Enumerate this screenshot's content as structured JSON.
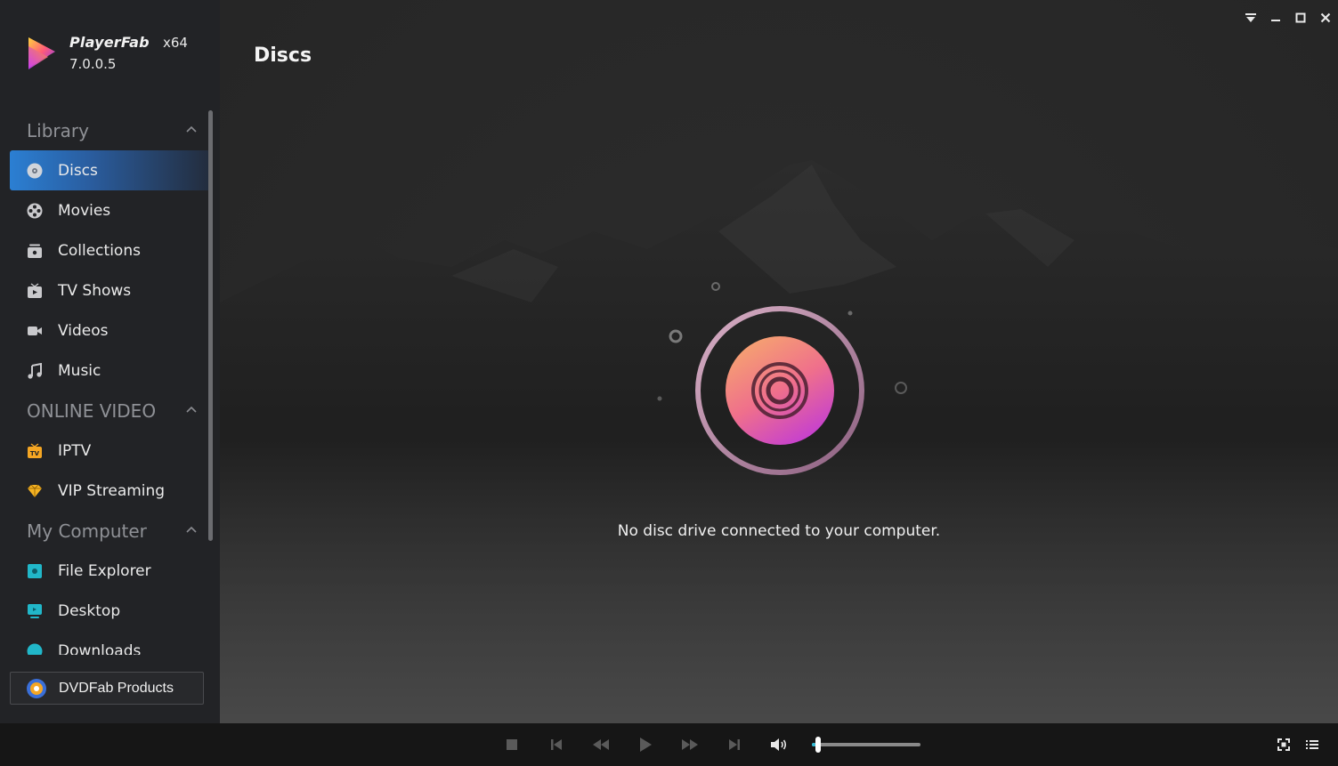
{
  "app": {
    "name": "PlayerFab",
    "arch": "x64",
    "version": "7.0.0.5"
  },
  "sidebar": {
    "sections": [
      {
        "title": "Library",
        "items": [
          {
            "label": "Discs",
            "icon": "disc-icon",
            "active": true
          },
          {
            "label": "Movies",
            "icon": "film-reel-icon"
          },
          {
            "label": "Collections",
            "icon": "collections-icon"
          },
          {
            "label": "TV Shows",
            "icon": "tv-shows-icon"
          },
          {
            "label": "Videos",
            "icon": "video-camera-icon"
          },
          {
            "label": "Music",
            "icon": "music-note-icon"
          }
        ]
      },
      {
        "title": "ONLINE VIDEO",
        "items": [
          {
            "label": "IPTV",
            "icon": "iptv-icon"
          },
          {
            "label": "VIP Streaming",
            "icon": "diamond-icon"
          }
        ]
      },
      {
        "title": "My Computer",
        "items": [
          {
            "label": "File Explorer",
            "icon": "folder-icon"
          },
          {
            "label": "Desktop",
            "icon": "monitor-icon"
          },
          {
            "label": "Downloads",
            "icon": "download-icon"
          }
        ]
      }
    ],
    "products_button": "DVDFab Products"
  },
  "main": {
    "title": "Discs",
    "empty_message": "No disc drive connected to your computer."
  },
  "player": {
    "volume_level": 0.03
  },
  "colors": {
    "accent_blue": "#2b7fd3",
    "volume_accent": "#2fbcd6",
    "disc_gradient_start": "#f4a070",
    "disc_gradient_end": "#c03ad8"
  }
}
